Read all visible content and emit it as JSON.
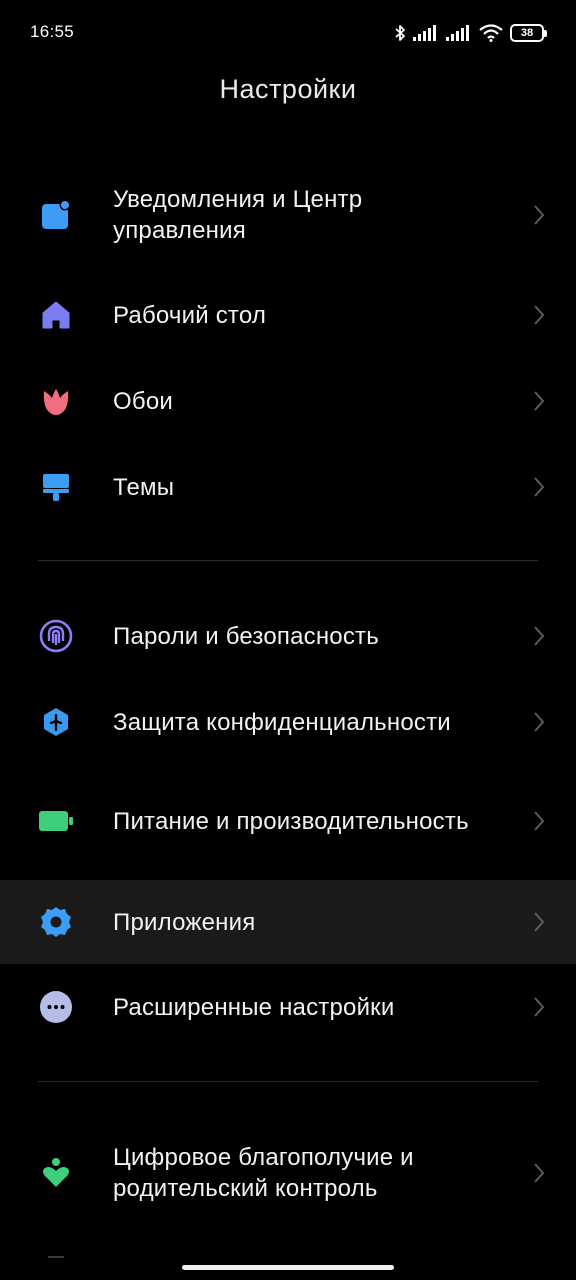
{
  "status_bar": {
    "time": "16:55",
    "battery": "38",
    "icons": [
      "bluetooth-icon",
      "signal-icon",
      "signal-icon",
      "wifi-icon",
      "battery-icon"
    ]
  },
  "title": "Настройки",
  "groups": [
    {
      "items": [
        {
          "label": "Уведомления и Центр управления",
          "icon": "notifications-icon",
          "color": "#3d9df5"
        },
        {
          "label": "Рабочий стол",
          "icon": "home-icon",
          "color": "#7b7cf0"
        },
        {
          "label": "Обои",
          "icon": "tulip-icon",
          "color": "#f26d80"
        },
        {
          "label": "Темы",
          "icon": "brush-icon",
          "color": "#3d9df5"
        }
      ]
    },
    {
      "items": [
        {
          "label": "Пароли и безопасность",
          "icon": "fingerprint-icon",
          "color": "#8a7ff5"
        },
        {
          "label": "Защита конфиденциальности",
          "icon": "privacy-icon",
          "color": "#3a9af0"
        },
        {
          "label": "Питание и производительность",
          "icon": "battery-icon",
          "color": "#3ecf7a"
        },
        {
          "label": "Приложения",
          "icon": "gear-icon",
          "color": "#3d9df5",
          "highlighted": true
        },
        {
          "label": "Расширенные настройки",
          "icon": "more-icon",
          "color": "#b3bde8"
        }
      ]
    },
    {
      "items": [
        {
          "label": "Цифровое благополучие и родительский контроль",
          "icon": "wellbeing-icon",
          "color": "#3ecf7a"
        }
      ]
    }
  ]
}
